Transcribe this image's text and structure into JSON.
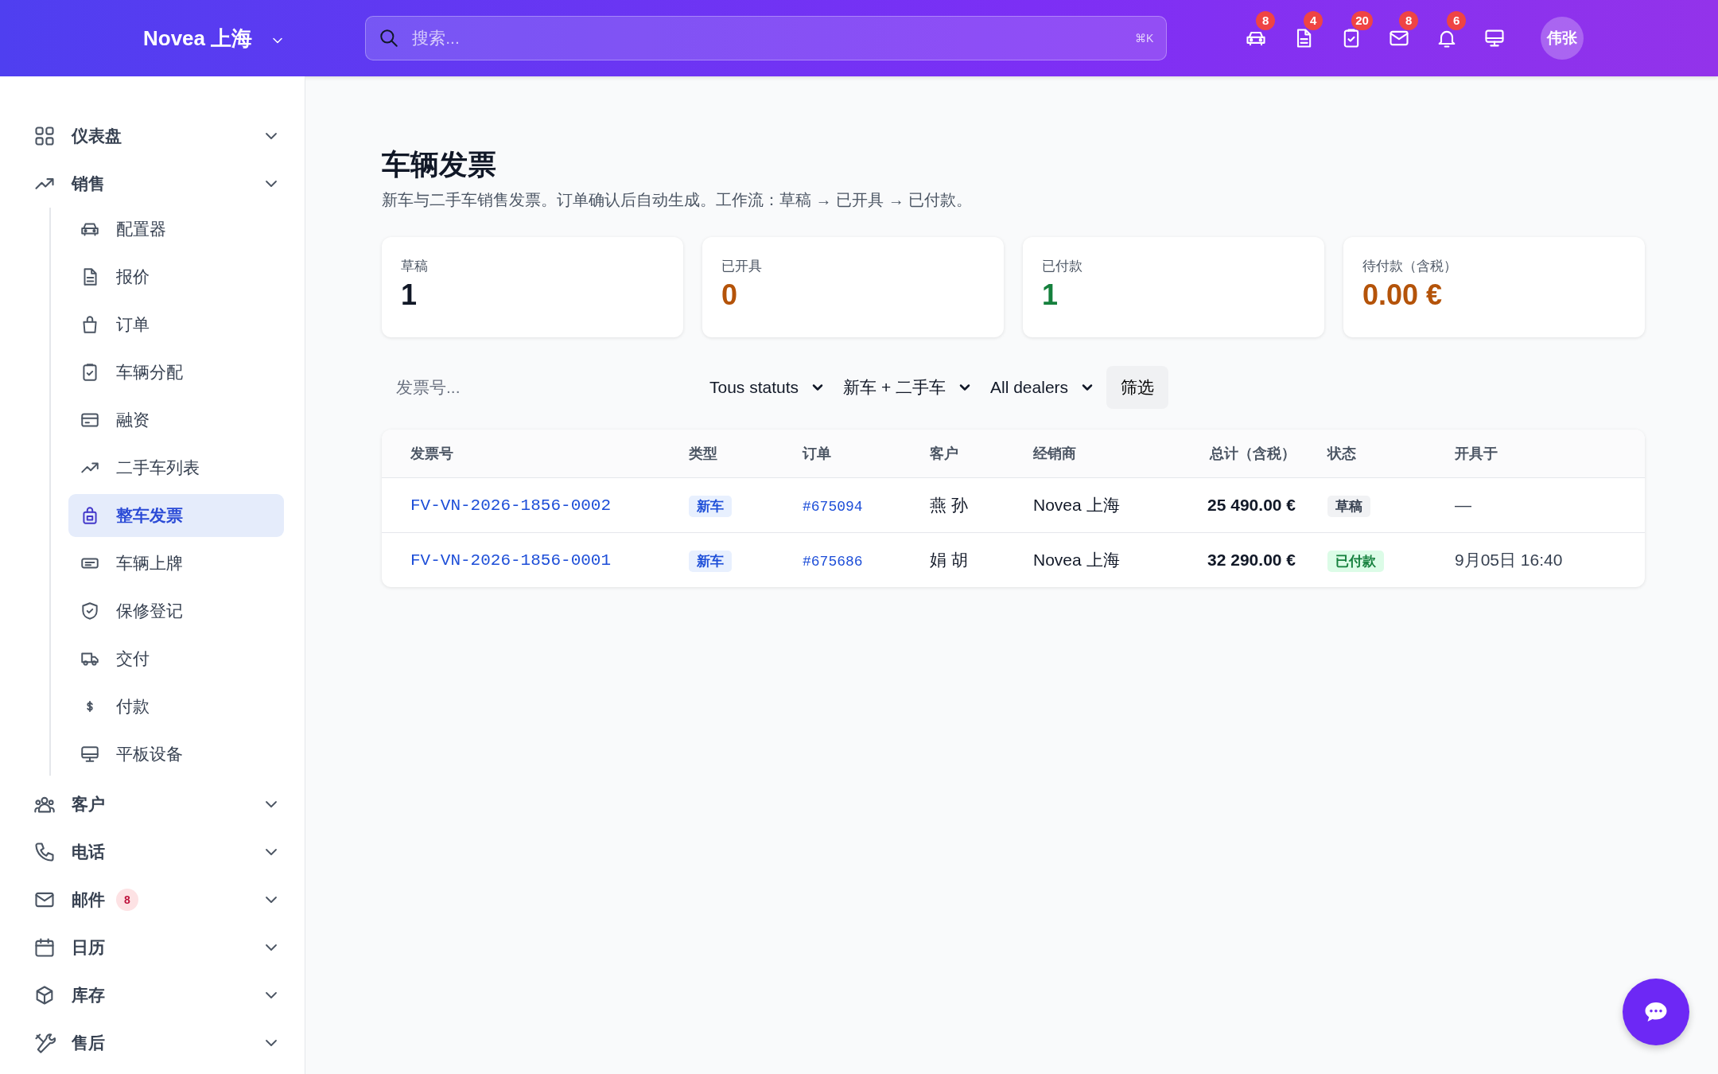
{
  "topbar": {
    "brand": "Novea 上海",
    "search": {
      "placeholder": "搜索...",
      "shortcut": "⌘K"
    },
    "actions": [
      {
        "badge": "8"
      },
      {
        "badge": "4"
      },
      {
        "badge": "20"
      },
      {
        "badge": "8"
      },
      {
        "badge": "6"
      }
    ],
    "avatar": "伟张"
  },
  "sidebar": {
    "items": [
      {
        "label": "仪表盘"
      },
      {
        "label": "销售",
        "children": [
          {
            "label": "配置器",
            "selected": false
          },
          {
            "label": "报价",
            "selected": false
          },
          {
            "label": "订单",
            "selected": false
          },
          {
            "label": "车辆分配",
            "selected": false
          },
          {
            "label": "融资",
            "selected": false
          },
          {
            "label": "二手车列表",
            "selected": false
          },
          {
            "label": "整车发票",
            "selected": true
          },
          {
            "label": "车辆上牌",
            "selected": false
          },
          {
            "label": "保修登记",
            "selected": false
          },
          {
            "label": "交付",
            "selected": false
          },
          {
            "label": "付款",
            "selected": false
          },
          {
            "label": "平板设备",
            "selected": false
          }
        ]
      },
      {
        "label": "客户"
      },
      {
        "label": "电话"
      },
      {
        "label": "邮件",
        "badge": "8"
      },
      {
        "label": "日历"
      },
      {
        "label": "库存"
      },
      {
        "label": "售后"
      }
    ]
  },
  "page": {
    "title": "车辆发票",
    "subtitle": "新车与二手车销售发票。订单确认后自动生成。工作流：草稿 → 已开具 → 已付款。"
  },
  "stats": [
    {
      "label": "草稿",
      "value": "1",
      "color": "#111827"
    },
    {
      "label": "已开具",
      "value": "0",
      "color": "#b45309"
    },
    {
      "label": "已付款",
      "value": "1",
      "color": "#15803d"
    },
    {
      "label": "待付款（含税）",
      "value": "0.00 €",
      "color": "#b45309"
    }
  ],
  "filters": {
    "search": {
      "placeholder": "发票号..."
    },
    "selects": [
      "Tous statuts",
      "新车 + 二手车",
      "All dealers"
    ],
    "button": "筛选"
  },
  "table": {
    "columns": [
      "发票号",
      "类型",
      "订单",
      "客户",
      "经销商",
      "总计（含税）",
      "状态",
      "开具于"
    ],
    "rows": [
      {
        "number": "FV-VN-2026-1856-0002",
        "type": "新车",
        "order": "#675094",
        "customer": "燕 孙",
        "dealer": "Novea 上海",
        "total": "25 490.00 €",
        "status": {
          "label": "草稿",
          "kind": "draft"
        },
        "issued": "—"
      },
      {
        "number": "FV-VN-2026-1856-0001",
        "type": "新车",
        "order": "#675686",
        "customer": "娟 胡",
        "dealer": "Novea 上海",
        "total": "32 290.00 €",
        "status": {
          "label": "已付款",
          "kind": "paid"
        },
        "issued": "9月05日 16:40"
      }
    ]
  }
}
